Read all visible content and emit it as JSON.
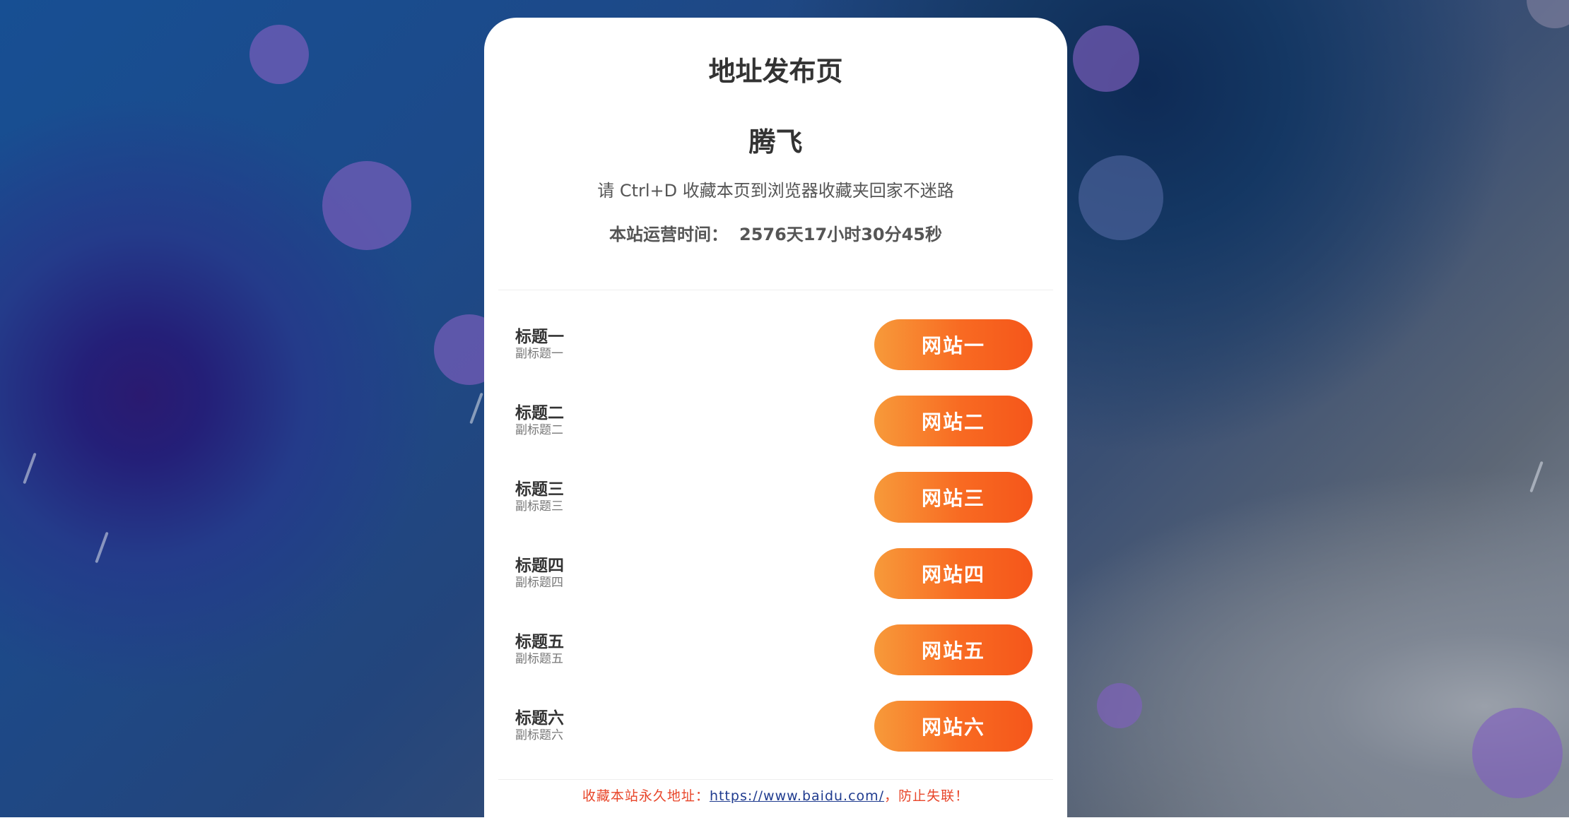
{
  "page": {
    "title": "地址发布页",
    "site_name": "腾飞",
    "bookmark_hint": "请 Ctrl+D 收藏本页到浏览器收藏夹回家不迷路",
    "runtime_label": "本站运营时间：",
    "runtime_value": "2576天17小时30分45秒"
  },
  "links": [
    {
      "title": "标题一",
      "subtitle": "副标题一",
      "button": "网站一"
    },
    {
      "title": "标题二",
      "subtitle": "副标题二",
      "button": "网站二"
    },
    {
      "title": "标题三",
      "subtitle": "副标题三",
      "button": "网站三"
    },
    {
      "title": "标题四",
      "subtitle": "副标题四",
      "button": "网站四"
    },
    {
      "title": "标题五",
      "subtitle": "副标题五",
      "button": "网站五"
    },
    {
      "title": "标题六",
      "subtitle": "副标题六",
      "button": "网站六"
    }
  ],
  "footer": {
    "prefix": "收藏本站永久地址：",
    "url": "https://www.baidu.com/",
    "suffix": "，防止失联！"
  },
  "colors": {
    "button_gradient_start": "#f79a3a",
    "button_gradient_end": "#f5561a",
    "footer_text": "#e8462a",
    "footer_link": "#1f3b8f"
  }
}
